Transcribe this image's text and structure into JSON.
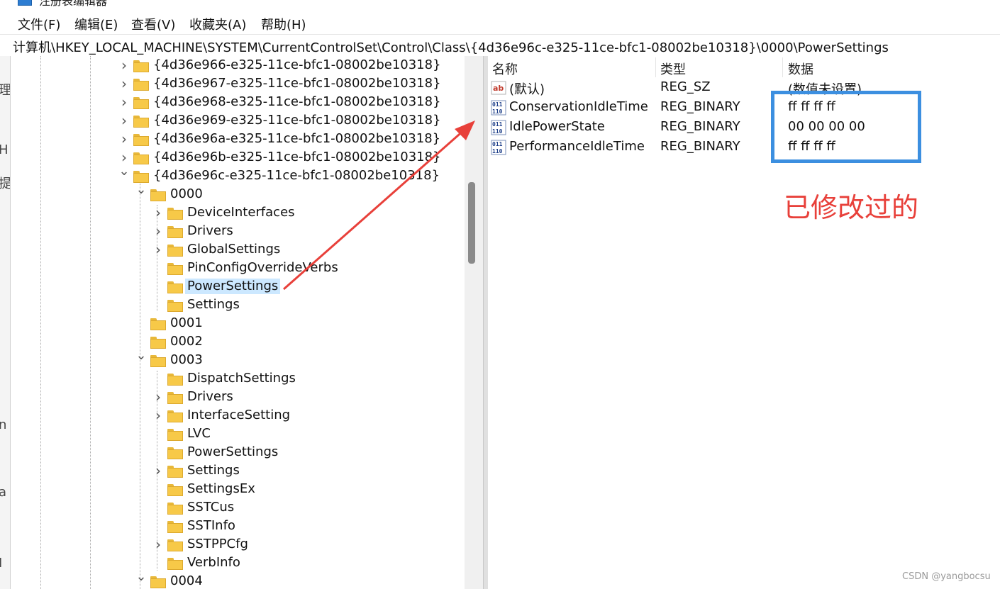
{
  "window": {
    "title": "注册表编辑器"
  },
  "menu": [
    {
      "label": "文件(F)"
    },
    {
      "label": "编辑(E)"
    },
    {
      "label": "查看(V)"
    },
    {
      "label": "收藏夹(A)"
    },
    {
      "label": "帮助(H)"
    }
  ],
  "address": {
    "path": "计算机\\HKEY_LOCAL_MACHINE\\SYSTEM\\CurrentControlSet\\Control\\Class\\{4d36e96c-e325-11ce-bfc1-08002be10318}\\0000\\PowerSettings"
  },
  "left_strip": {
    "chars": [
      "理",
      "H",
      "提",
      "",
      "",
      "",
      "",
      "n",
      "a",
      "I"
    ]
  },
  "tree": {
    "items": [
      {
        "label": "{4d36e966-e325-11ce-bfc1-08002be10318}",
        "depth": 0,
        "expander": "collapsed"
      },
      {
        "label": "{4d36e967-e325-11ce-bfc1-08002be10318}",
        "depth": 0,
        "expander": "collapsed"
      },
      {
        "label": "{4d36e968-e325-11ce-bfc1-08002be10318}",
        "depth": 0,
        "expander": "collapsed"
      },
      {
        "label": "{4d36e969-e325-11ce-bfc1-08002be10318}",
        "depth": 0,
        "expander": "collapsed"
      },
      {
        "label": "{4d36e96a-e325-11ce-bfc1-08002be10318}",
        "depth": 0,
        "expander": "collapsed"
      },
      {
        "label": "{4d36e96b-e325-11ce-bfc1-08002be10318}",
        "depth": 0,
        "expander": "collapsed"
      },
      {
        "label": "{4d36e96c-e325-11ce-bfc1-08002be10318}",
        "depth": 0,
        "expander": "expanded"
      },
      {
        "label": "0000",
        "depth": 1,
        "expander": "expanded"
      },
      {
        "label": "DeviceInterfaces",
        "depth": 2,
        "expander": "collapsed"
      },
      {
        "label": "Drivers",
        "depth": 2,
        "expander": "collapsed"
      },
      {
        "label": "GlobalSettings",
        "depth": 2,
        "expander": "collapsed"
      },
      {
        "label": "PinConfigOverrideVerbs",
        "depth": 2,
        "expander": "none"
      },
      {
        "label": "PowerSettings",
        "depth": 2,
        "expander": "none",
        "selected": true
      },
      {
        "label": "Settings",
        "depth": 2,
        "expander": "none"
      },
      {
        "label": "0001",
        "depth": 1,
        "expander": "none"
      },
      {
        "label": "0002",
        "depth": 1,
        "expander": "none"
      },
      {
        "label": "0003",
        "depth": 1,
        "expander": "expanded"
      },
      {
        "label": "DispatchSettings",
        "depth": 2,
        "expander": "none"
      },
      {
        "label": "Drivers",
        "depth": 2,
        "expander": "collapsed"
      },
      {
        "label": "InterfaceSetting",
        "depth": 2,
        "expander": "collapsed"
      },
      {
        "label": "LVC",
        "depth": 2,
        "expander": "none"
      },
      {
        "label": "PowerSettings",
        "depth": 2,
        "expander": "none"
      },
      {
        "label": "Settings",
        "depth": 2,
        "expander": "collapsed"
      },
      {
        "label": "SettingsEx",
        "depth": 2,
        "expander": "none"
      },
      {
        "label": "SSTCus",
        "depth": 2,
        "expander": "none"
      },
      {
        "label": "SSTInfo",
        "depth": 2,
        "expander": "none"
      },
      {
        "label": "SSTPPCfg",
        "depth": 2,
        "expander": "collapsed"
      },
      {
        "label": "VerbInfo",
        "depth": 2,
        "expander": "none"
      },
      {
        "label": "0004",
        "depth": 1,
        "expander": "expanded"
      }
    ]
  },
  "values": {
    "headers": {
      "name": "名称",
      "type": "类型",
      "data": "数据"
    },
    "rows": [
      {
        "icon": "string-value-icon",
        "name": "(默认)",
        "type": "REG_SZ",
        "data": "(数值未设置)"
      },
      {
        "icon": "binary-value-icon",
        "name": "ConservationIdleTime",
        "type": "REG_BINARY",
        "data": "ff ff ff ff"
      },
      {
        "icon": "binary-value-icon",
        "name": "IdlePowerState",
        "type": "REG_BINARY",
        "data": "00 00 00 00"
      },
      {
        "icon": "binary-value-icon",
        "name": "PerformanceIdleTime",
        "type": "REG_BINARY",
        "data": "ff ff ff ff"
      }
    ]
  },
  "annotation": {
    "text": "已修改过的",
    "color": "#e8403a",
    "box_color": "#3c8fe0"
  },
  "watermark": {
    "text": "CSDN @yangbocsu"
  }
}
